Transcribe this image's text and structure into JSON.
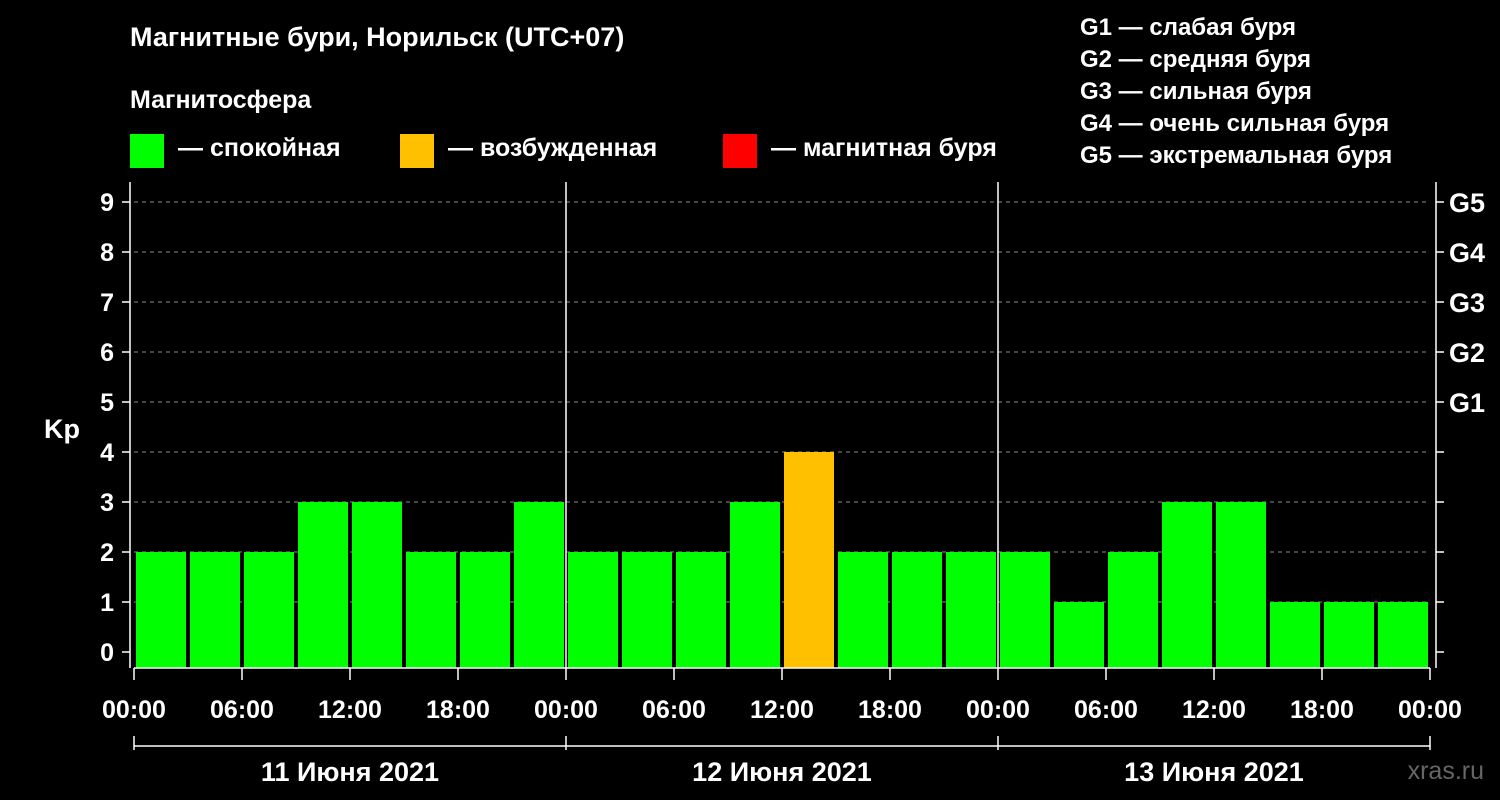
{
  "header": {
    "title": "Магнитные бури, Норильск (UTC+07)",
    "subtitle": "Магнитосфера",
    "legend": [
      {
        "label": "— спокойная",
        "color": "#00ff00"
      },
      {
        "label": "— возбужденная",
        "color": "#ffc000"
      },
      {
        "label": "— магнитная буря",
        "color": "#ff0000"
      }
    ]
  },
  "g_scale": [
    "G1 — слабая буря",
    "G2 — средняя буря",
    "G3 — сильная буря",
    "G4 — очень сильная буря",
    "G5 — экстремальная буря"
  ],
  "credit": "xras.ru",
  "chart_data": {
    "type": "bar",
    "ylabel": "Kp",
    "ylim": [
      0,
      9
    ],
    "yticks": [
      "0",
      "1",
      "2",
      "3",
      "4",
      "5",
      "6",
      "7",
      "8",
      "9"
    ],
    "right_labels": [
      {
        "kp": 5,
        "label": "G1"
      },
      {
        "kp": 6,
        "label": "G2"
      },
      {
        "kp": 7,
        "label": "G3"
      },
      {
        "kp": 8,
        "label": "G4"
      },
      {
        "kp": 9,
        "label": "G5"
      }
    ],
    "x_tick_labels": [
      "00:00",
      "06:00",
      "12:00",
      "18:00",
      "00:00",
      "06:00",
      "12:00",
      "18:00",
      "00:00",
      "06:00",
      "12:00",
      "18:00",
      "00:00"
    ],
    "day_labels": [
      "11 Июня 2021",
      "12 Июня 2021",
      "13 Июня 2021"
    ],
    "bars": [
      {
        "start": "00:00",
        "kp": 2,
        "status": "calm"
      },
      {
        "start": "03:00",
        "kp": 2,
        "status": "calm"
      },
      {
        "start": "06:00",
        "kp": 2,
        "status": "calm"
      },
      {
        "start": "09:00",
        "kp": 3,
        "status": "calm"
      },
      {
        "start": "12:00",
        "kp": 3,
        "status": "calm"
      },
      {
        "start": "15:00",
        "kp": 2,
        "status": "calm"
      },
      {
        "start": "18:00",
        "kp": 2,
        "status": "calm"
      },
      {
        "start": "21:00",
        "kp": 3,
        "status": "calm"
      },
      {
        "start": "00:00",
        "kp": 2,
        "status": "calm"
      },
      {
        "start": "03:00",
        "kp": 2,
        "status": "calm"
      },
      {
        "start": "06:00",
        "kp": 2,
        "status": "calm"
      },
      {
        "start": "09:00",
        "kp": 3,
        "status": "calm"
      },
      {
        "start": "12:00",
        "kp": 4,
        "status": "active"
      },
      {
        "start": "15:00",
        "kp": 2,
        "status": "calm"
      },
      {
        "start": "18:00",
        "kp": 2,
        "status": "calm"
      },
      {
        "start": "21:00",
        "kp": 2,
        "status": "calm"
      },
      {
        "start": "00:00",
        "kp": 2,
        "status": "calm"
      },
      {
        "start": "03:00",
        "kp": 1,
        "status": "calm"
      },
      {
        "start": "06:00",
        "kp": 2,
        "status": "calm"
      },
      {
        "start": "09:00",
        "kp": 3,
        "status": "calm"
      },
      {
        "start": "12:00",
        "kp": 3,
        "status": "calm"
      },
      {
        "start": "15:00",
        "kp": 1,
        "status": "calm"
      },
      {
        "start": "18:00",
        "kp": 1,
        "status": "calm"
      },
      {
        "start": "21:00",
        "kp": 1,
        "status": "calm"
      }
    ],
    "status_colors": {
      "calm": "#00ff00",
      "active": "#ffc000",
      "storm": "#ff0000"
    },
    "grid": "dashed horizontal"
  }
}
